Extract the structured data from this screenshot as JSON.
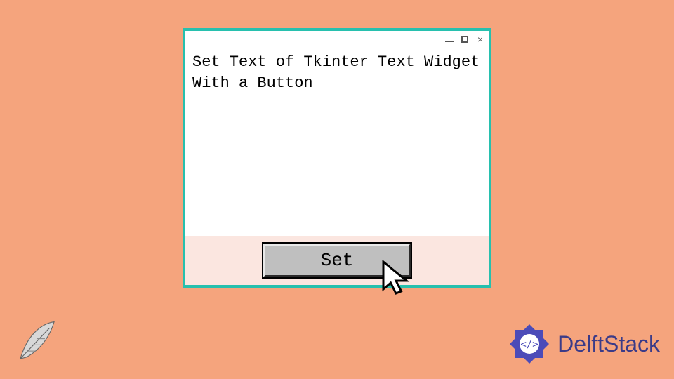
{
  "window": {
    "text_content": "Set Text of Tkinter Text Widget With a Button",
    "button_label": "Set",
    "titlebar": {
      "minimize": "—",
      "maximize": "□",
      "close": "×"
    }
  },
  "brand": {
    "name": "DelftStack"
  },
  "colors": {
    "background": "#f5a47d",
    "window_border": "#27c0ae",
    "button_face": "#bfbfbf",
    "brand_color": "#3b3b88"
  }
}
